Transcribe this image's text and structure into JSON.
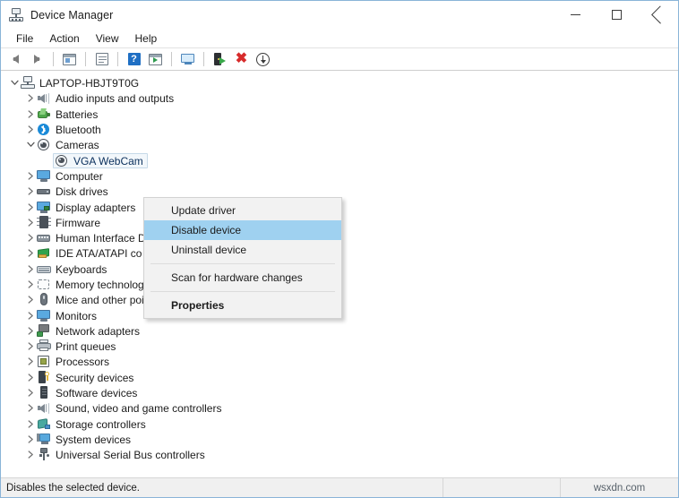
{
  "window": {
    "title": "Device Manager",
    "app_icon": "device-manager-icon",
    "controls": {
      "minimize": "Minimize",
      "maximize": "Maximize",
      "close": "Close"
    }
  },
  "menubar": {
    "items": [
      {
        "label": "File"
      },
      {
        "label": "Action"
      },
      {
        "label": "View"
      },
      {
        "label": "Help"
      }
    ]
  },
  "toolbar": {
    "buttons": [
      {
        "name": "back-arrow-icon",
        "title": "Back"
      },
      {
        "name": "forward-arrow-icon",
        "title": "Forward"
      },
      {
        "name": "separator-1"
      },
      {
        "name": "show-hide-console-tree-icon",
        "title": "Show/Hide Console Tree"
      },
      {
        "name": "separator-2"
      },
      {
        "name": "properties-icon",
        "title": "Properties"
      },
      {
        "name": "separator-3"
      },
      {
        "name": "help-icon",
        "title": "Help"
      },
      {
        "name": "scan-for-hardware-changes-icon",
        "title": "Scan for hardware changes"
      },
      {
        "name": "separator-4"
      },
      {
        "name": "show-hide-action-pane-icon",
        "title": "Show/Hide Action Pane"
      },
      {
        "name": "separator-5"
      },
      {
        "name": "update-driver-icon",
        "title": "Update driver"
      },
      {
        "name": "uninstall-device-icon",
        "title": "Uninstall device"
      },
      {
        "name": "disable-device-icon",
        "title": "Disable device"
      }
    ]
  },
  "tree": {
    "nodes": [
      {
        "label": "LAPTOP-HBJT9T0G",
        "level": 0,
        "state": "expanded",
        "icon": "computer-root-icon",
        "icon_class": "i-computer-root",
        "selected": false
      },
      {
        "label": "Audio inputs and outputs",
        "level": 1,
        "state": "collapsed",
        "icon": "speaker-icon",
        "icon_class": "i-speaker",
        "selected": false
      },
      {
        "label": "Batteries",
        "level": 1,
        "state": "collapsed",
        "icon": "battery-icon",
        "icon_class": "i-battery",
        "selected": false
      },
      {
        "label": "Bluetooth",
        "level": 1,
        "state": "collapsed",
        "icon": "bluetooth-icon",
        "icon_class": "i-bt",
        "selected": false
      },
      {
        "label": "Cameras",
        "level": 1,
        "state": "expanded",
        "icon": "camera-icon",
        "icon_class": "i-cam",
        "selected": false
      },
      {
        "label": "VGA WebCam",
        "level": 2,
        "state": "leaf",
        "icon": "camera-icon",
        "icon_class": "i-cam",
        "selected": true
      },
      {
        "label": "Computer",
        "level": 1,
        "state": "collapsed",
        "icon": "monitor-icon",
        "icon_class": "i-monitor",
        "selected": false
      },
      {
        "label": "Disk drives",
        "level": 1,
        "state": "collapsed",
        "icon": "disk-drive-icon",
        "icon_class": "i-disk",
        "selected": false
      },
      {
        "label": "Display adapters",
        "level": 1,
        "state": "collapsed",
        "icon": "display-adapter-icon",
        "icon_class": "i-display",
        "selected": false
      },
      {
        "label": "Firmware",
        "level": 1,
        "state": "collapsed",
        "icon": "firmware-icon",
        "icon_class": "i-fw",
        "selected": false
      },
      {
        "label": "Human Interface D",
        "level": 1,
        "state": "collapsed",
        "icon": "human-interface-device-icon",
        "icon_class": "i-hid",
        "selected": false
      },
      {
        "label": "IDE ATA/ATAPI co",
        "level": 1,
        "state": "collapsed",
        "icon": "ide-controller-icon",
        "icon_class": "i-ide",
        "selected": false
      },
      {
        "label": "Keyboards",
        "level": 1,
        "state": "collapsed",
        "icon": "keyboard-icon",
        "icon_class": "i-kb",
        "selected": false
      },
      {
        "label": "Memory technology devices",
        "level": 1,
        "state": "collapsed",
        "icon": "memory-technology-icon",
        "icon_class": "i-mem",
        "selected": false
      },
      {
        "label": "Mice and other pointing devices",
        "level": 1,
        "state": "collapsed",
        "icon": "mouse-icon",
        "icon_class": "i-mouse",
        "selected": false
      },
      {
        "label": "Monitors",
        "level": 1,
        "state": "collapsed",
        "icon": "monitor-icon",
        "icon_class": "i-monitor",
        "selected": false
      },
      {
        "label": "Network adapters",
        "level": 1,
        "state": "collapsed",
        "icon": "network-adapter-icon",
        "icon_class": "i-net",
        "selected": false
      },
      {
        "label": "Print queues",
        "level": 1,
        "state": "collapsed",
        "icon": "printer-icon",
        "icon_class": "i-print",
        "selected": false
      },
      {
        "label": "Processors",
        "level": 1,
        "state": "collapsed",
        "icon": "processor-icon",
        "icon_class": "i-cpu",
        "selected": false
      },
      {
        "label": "Security devices",
        "level": 1,
        "state": "collapsed",
        "icon": "security-device-icon",
        "icon_class": "i-sec",
        "selected": false
      },
      {
        "label": "Software devices",
        "level": 1,
        "state": "collapsed",
        "icon": "software-device-icon",
        "icon_class": "i-sw",
        "selected": false
      },
      {
        "label": "Sound, video and game controllers",
        "level": 1,
        "state": "collapsed",
        "icon": "speaker-icon",
        "icon_class": "i-speaker",
        "selected": false
      },
      {
        "label": "Storage controllers",
        "level": 1,
        "state": "collapsed",
        "icon": "storage-controller-icon",
        "icon_class": "i-storage",
        "selected": false
      },
      {
        "label": "System devices",
        "level": 1,
        "state": "collapsed",
        "icon": "system-device-icon",
        "icon_class": "i-sys",
        "selected": false
      },
      {
        "label": "Universal Serial Bus controllers",
        "level": 1,
        "state": "collapsed",
        "icon": "usb-controller-icon",
        "icon_class": "i-usb",
        "selected": false
      }
    ]
  },
  "context_menu": {
    "items": [
      {
        "label": "Update driver",
        "type": "item",
        "highlighted": false,
        "bold": false
      },
      {
        "label": "Disable device",
        "type": "item",
        "highlighted": true,
        "bold": false
      },
      {
        "label": "Uninstall device",
        "type": "item",
        "highlighted": false,
        "bold": false
      },
      {
        "type": "separator"
      },
      {
        "label": "Scan for hardware changes",
        "type": "item",
        "highlighted": false,
        "bold": false
      },
      {
        "type": "separator"
      },
      {
        "label": "Properties",
        "type": "item",
        "highlighted": false,
        "bold": true
      }
    ]
  },
  "statusbar": {
    "text": "Disables the selected device.",
    "watermark": "wsxdn.com"
  },
  "colors": {
    "window_border": "#8ab4d8",
    "menu_highlight": "#9fd1f0",
    "menu_background": "#f2f2f2",
    "selection_fill": "#f2f7fb",
    "selection_border": "#c6d9e8",
    "statusbar_background": "#f0f0f0"
  }
}
